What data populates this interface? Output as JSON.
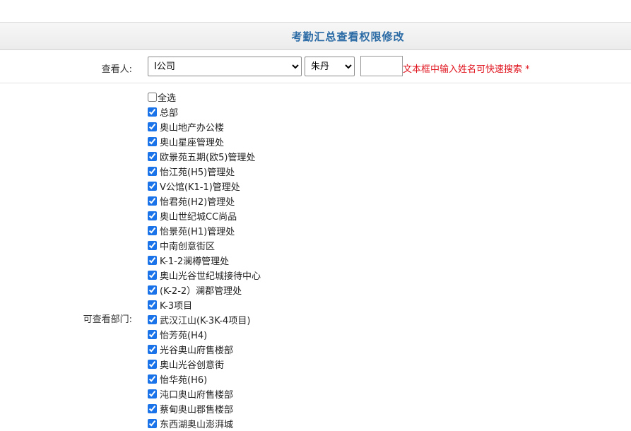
{
  "header": {
    "title": "考勤汇总查看权限修改"
  },
  "viewer": {
    "label": "查看人:",
    "company_selected": "Ⅰ公司",
    "person_selected": "朱丹",
    "search_value": "",
    "hint": "文本框中输入姓名可快速搜索 *"
  },
  "departments": {
    "label": "可查看部门:",
    "select_all_label": "全选",
    "select_all_checked": false,
    "items": [
      {
        "label": "总部",
        "checked": true
      },
      {
        "label": "奥山地产办公楼",
        "checked": true
      },
      {
        "label": "奥山星座管理处",
        "checked": true
      },
      {
        "label": "欧景苑五期(欧5)管理处",
        "checked": true
      },
      {
        "label": "怡江苑(H5)管理处",
        "checked": true
      },
      {
        "label": "V公馆(K1-1)管理处",
        "checked": true
      },
      {
        "label": "怡君苑(H2)管理处",
        "checked": true
      },
      {
        "label": "奥山世纪城CC尚品",
        "checked": true
      },
      {
        "label": "怡景苑(H1)管理处",
        "checked": true
      },
      {
        "label": "中南创意街区",
        "checked": true
      },
      {
        "label": "K-1-2澜樽管理处",
        "checked": true
      },
      {
        "label": "奥山光谷世纪城接待中心",
        "checked": true
      },
      {
        "label": "(K-2-2）澜郡管理处",
        "checked": true
      },
      {
        "label": "K-3项目",
        "checked": true
      },
      {
        "label": "武汉江山(K-3K-4项目)",
        "checked": true
      },
      {
        "label": "怡芳苑(H4)",
        "checked": true
      },
      {
        "label": "光谷奥山府售楼部",
        "checked": true
      },
      {
        "label": "奥山光谷创意街",
        "checked": true
      },
      {
        "label": "怡华苑(H6)",
        "checked": true
      },
      {
        "label": "沌口奥山府售楼部",
        "checked": true
      },
      {
        "label": "蔡甸奥山郡售楼部",
        "checked": true
      },
      {
        "label": "东西湖奥山澎湃城",
        "checked": true
      }
    ]
  }
}
